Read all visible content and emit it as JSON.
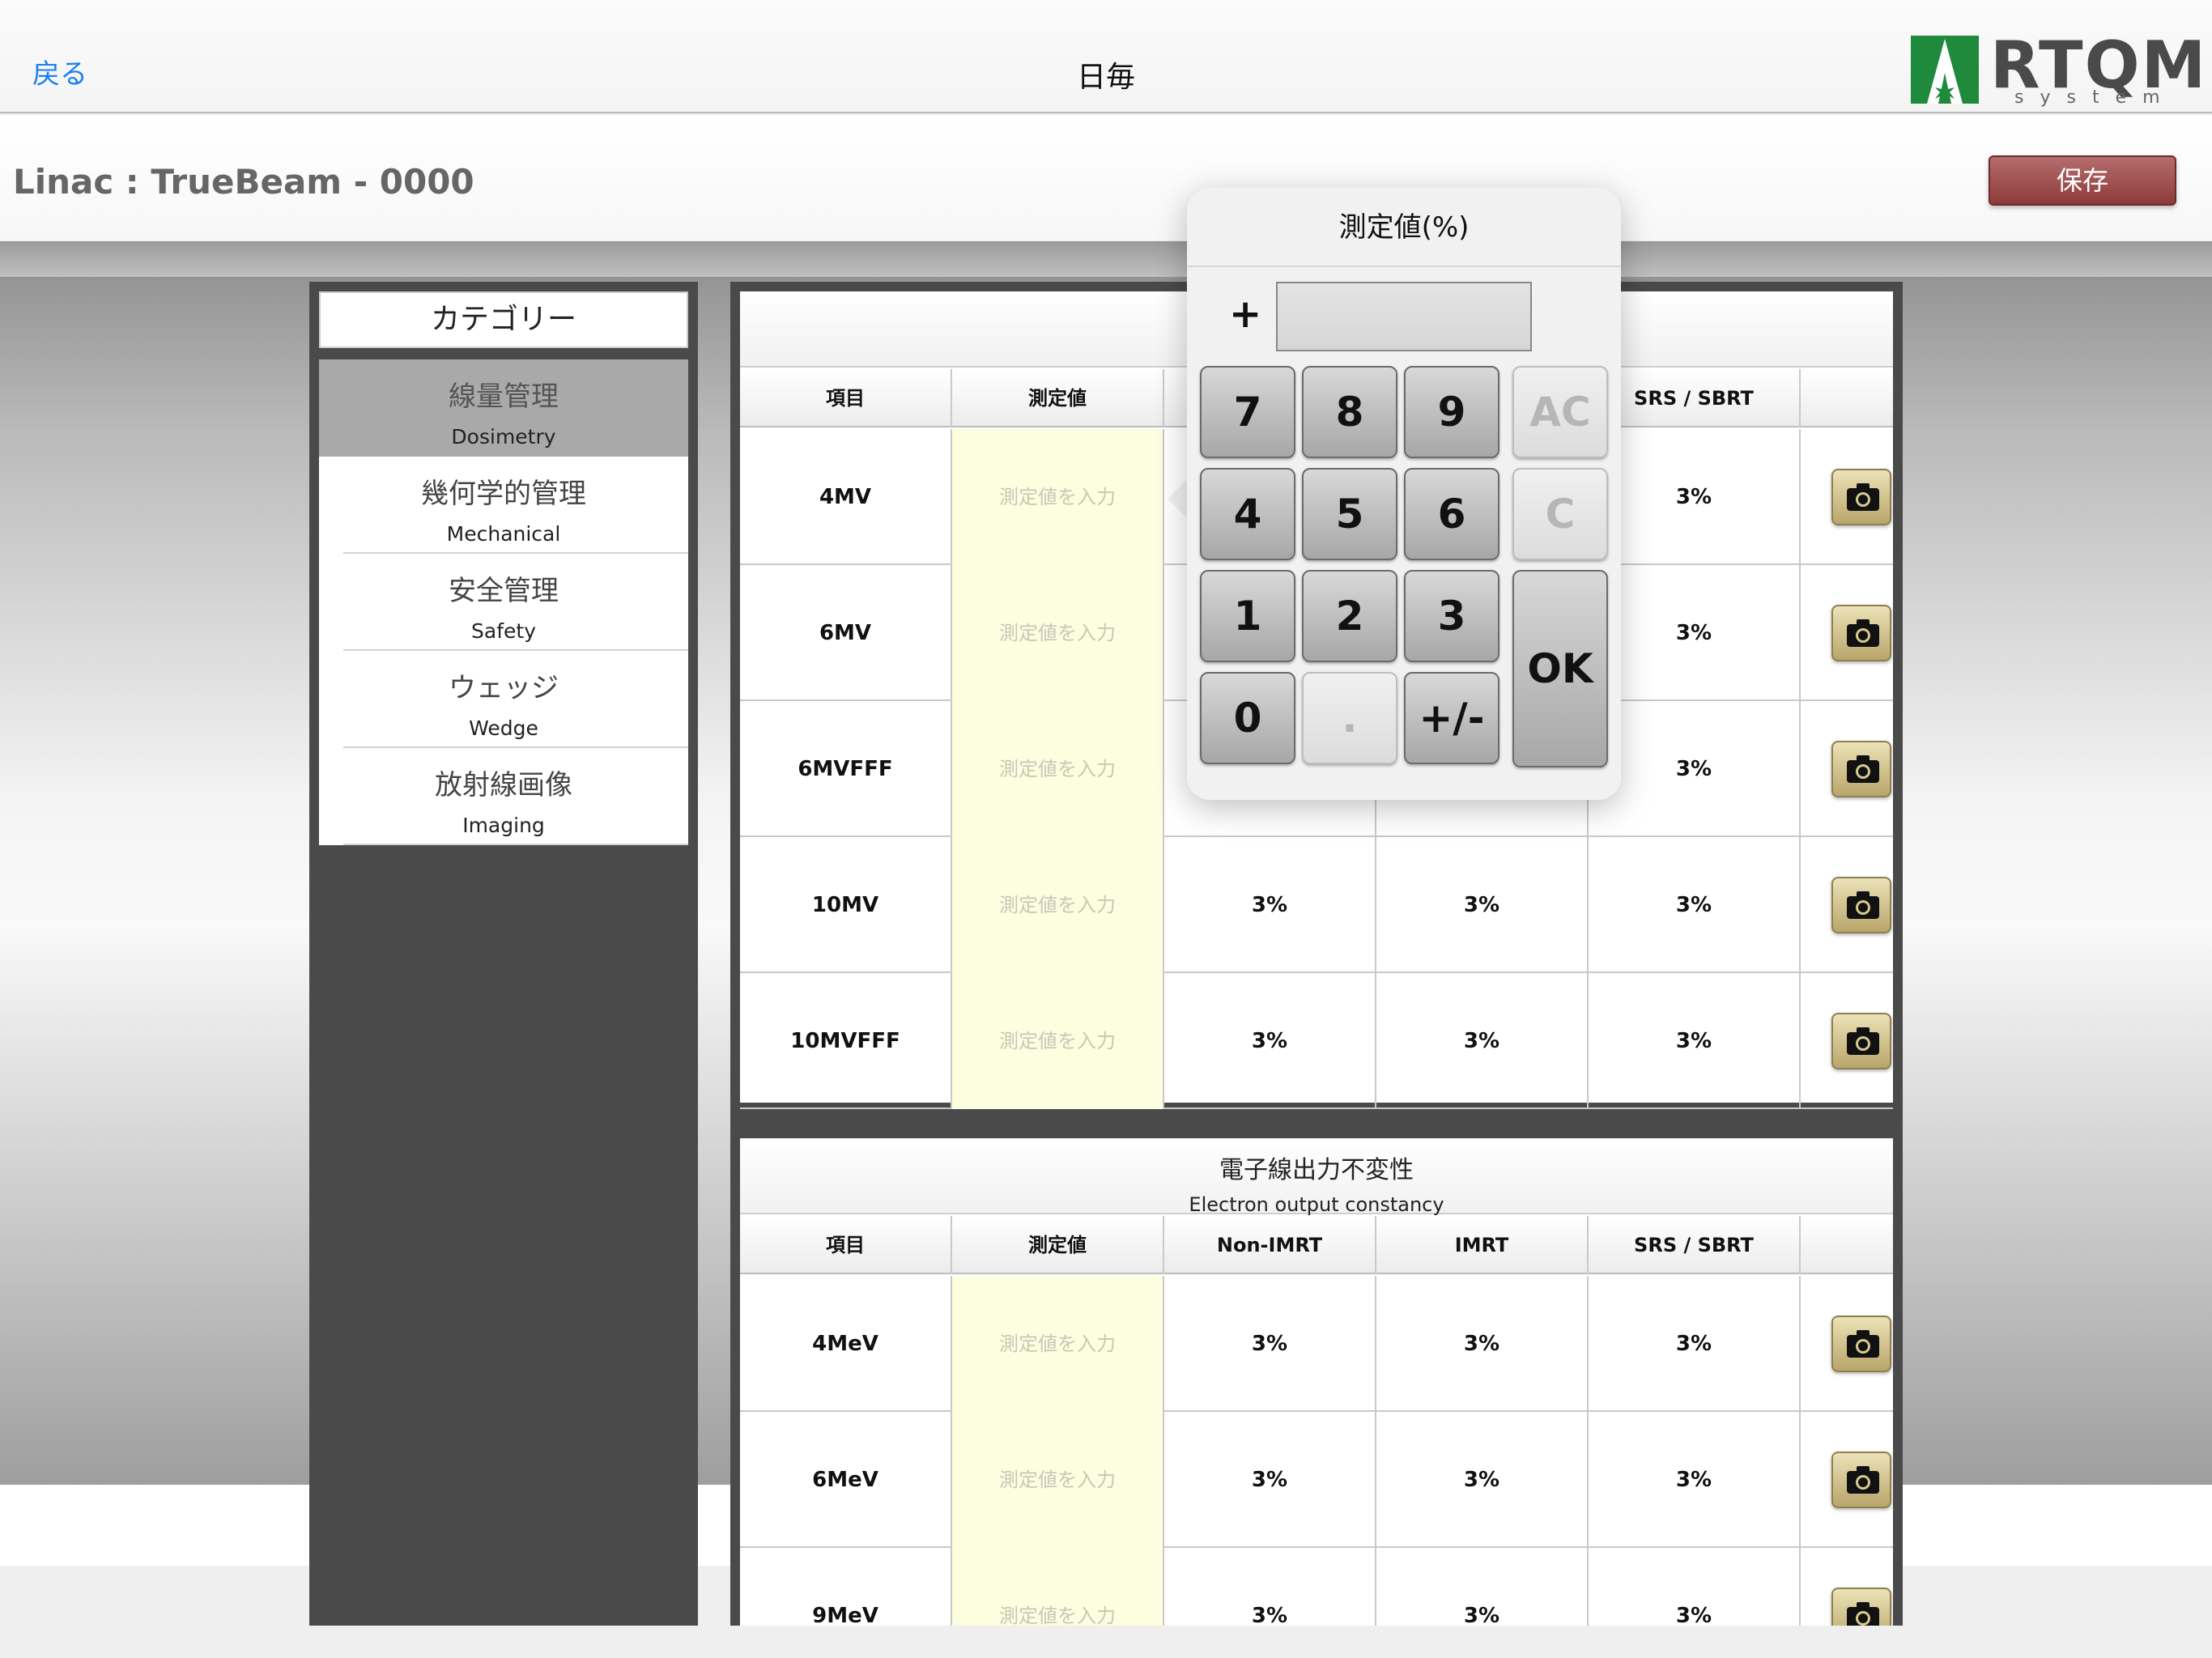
{
  "nav": {
    "back_label": "戻る",
    "title": "日毎",
    "logo_text": "RTQM",
    "logo_sub": "system"
  },
  "header": {
    "linac_label": "Linac :  TrueBeam - 0000",
    "save_label": "保存"
  },
  "category": {
    "title": "カテゴリー",
    "items": [
      {
        "jp": "線量管理",
        "en": "Dosimetry",
        "selected": true
      },
      {
        "jp": "幾何学的管理",
        "en": "Mechanical",
        "selected": false
      },
      {
        "jp": "安全管理",
        "en": "Safety",
        "selected": false
      },
      {
        "jp": "ウェッジ",
        "en": "Wedge",
        "selected": false
      },
      {
        "jp": "放射線画像",
        "en": "Imaging",
        "selected": false
      }
    ]
  },
  "photon_table": {
    "columns": [
      "項目",
      "測定値",
      "",
      "",
      "SRS / SBRT",
      ""
    ],
    "input_placeholder": "測定値を入力",
    "rows": [
      {
        "item": "4MV",
        "nonimrt": "",
        "imrt": "",
        "srs": "3%"
      },
      {
        "item": "6MV",
        "nonimrt": "",
        "imrt": "",
        "srs": "3%"
      },
      {
        "item": "6MVFFF",
        "nonimrt": "",
        "imrt": "",
        "srs": "3%"
      },
      {
        "item": "10MV",
        "nonimrt": "3%",
        "imrt": "3%",
        "srs": "3%"
      },
      {
        "item": "10MVFFF",
        "nonimrt": "3%",
        "imrt": "3%",
        "srs": "3%"
      }
    ]
  },
  "electron_table": {
    "title_jp": "電子線出力不変性",
    "title_en": "Electron output constancy",
    "columns": [
      "項目",
      "測定値",
      "Non-IMRT",
      "IMRT",
      "SRS / SBRT",
      ""
    ],
    "input_placeholder": "測定値を入力",
    "rows": [
      {
        "item": "4MeV",
        "nonimrt": "3%",
        "imrt": "3%",
        "srs": "3%"
      },
      {
        "item": "6MeV",
        "nonimrt": "3%",
        "imrt": "3%",
        "srs": "3%"
      },
      {
        "item": "9MeV",
        "nonimrt": "3%",
        "imrt": "3%",
        "srs": "3%"
      }
    ]
  },
  "keypad": {
    "title": "測定値(%)",
    "sign": "+",
    "display_value": "",
    "keys": {
      "k7": "7",
      "k8": "8",
      "k9": "9",
      "ac": "AC",
      "k4": "4",
      "k5": "5",
      "k6": "6",
      "c": "C",
      "k1": "1",
      "k2": "2",
      "k3": "3",
      "ok": "OK",
      "k0": "0",
      "dot": ".",
      "pm": "+/-"
    }
  },
  "colors": {
    "link_blue": "#1a7ff0",
    "save_red": "#8e3a3a",
    "input_yellow": "#fdfde0",
    "panel_dark": "#4a4a4a",
    "logo_green": "#1f8a3c"
  }
}
